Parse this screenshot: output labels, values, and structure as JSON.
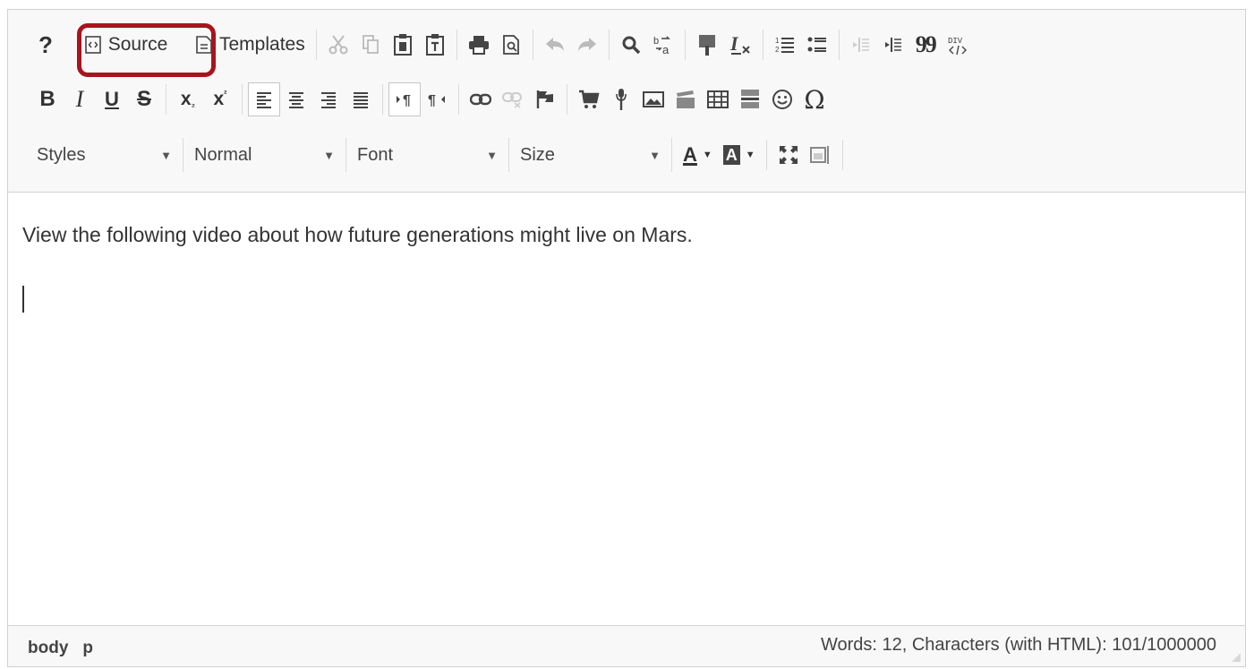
{
  "toolbar": {
    "help_label": "?",
    "source_label": "Source",
    "templates_label": "Templates",
    "bold_label": "B",
    "italic_label": "I",
    "underline_label": "U",
    "strike_label": "S",
    "sub_label": "x",
    "sup_label": "x",
    "omega_label": "Ω",
    "blockquote_label": "99",
    "styles_label": "Styles",
    "format_label": "Normal",
    "font_label": "Font",
    "size_label": "Size",
    "text_color_label": "A",
    "bg_color_label": "A"
  },
  "content": {
    "paragraph": "View the following video about how future generations might live on Mars."
  },
  "status": {
    "path": [
      "body",
      "p"
    ],
    "word_count": "Words: 12, Characters (with HTML): 101/1000000"
  },
  "colors": {
    "highlight": "#a7141e",
    "toolbar_bg": "#f8f8f8",
    "border": "#d1d1d1"
  }
}
